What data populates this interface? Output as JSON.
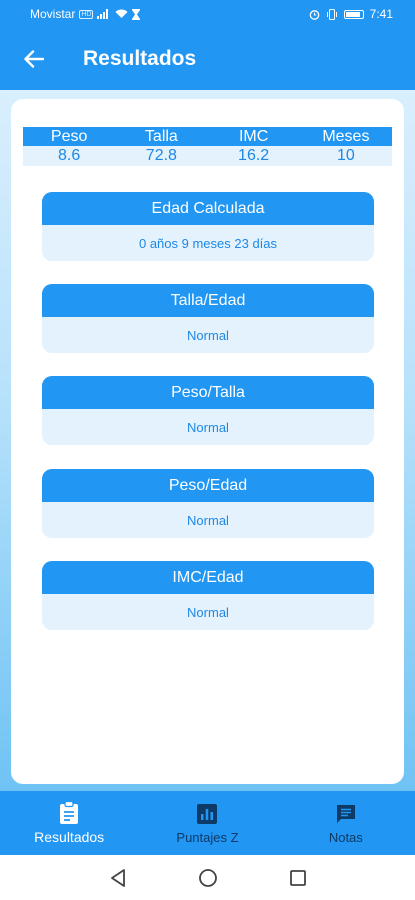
{
  "status_bar": {
    "carrier": "Movistar",
    "carrier_badge": "HD",
    "time": "7:41"
  },
  "app_bar": {
    "title": "Resultados",
    "back_icon": "arrow-left-icon"
  },
  "summary": {
    "headers": [
      "Peso",
      "Talla",
      "IMC",
      "Meses"
    ],
    "values": [
      "8.6",
      "72.8",
      "16.2",
      "10"
    ]
  },
  "results": [
    {
      "title": "Edad Calculada",
      "value": "0 años 9 meses 23 días"
    },
    {
      "title": "Talla/Edad",
      "value": "Normal"
    },
    {
      "title": "Peso/Talla",
      "value": "Normal"
    },
    {
      "title": "Peso/Edad",
      "value": "Normal"
    },
    {
      "title": "IMC/Edad",
      "value": "Normal"
    }
  ],
  "bottom_nav": {
    "items": [
      {
        "label": "Resultados",
        "icon": "clipboard-icon",
        "active": true
      },
      {
        "label": "Puntajes Z",
        "icon": "bar-chart-icon",
        "active": false
      },
      {
        "label": "Notas",
        "icon": "message-icon",
        "active": false
      }
    ]
  },
  "colors": {
    "primary": "#2196f3",
    "light": "#e3f2fd",
    "text_value": "#1e88e5"
  }
}
